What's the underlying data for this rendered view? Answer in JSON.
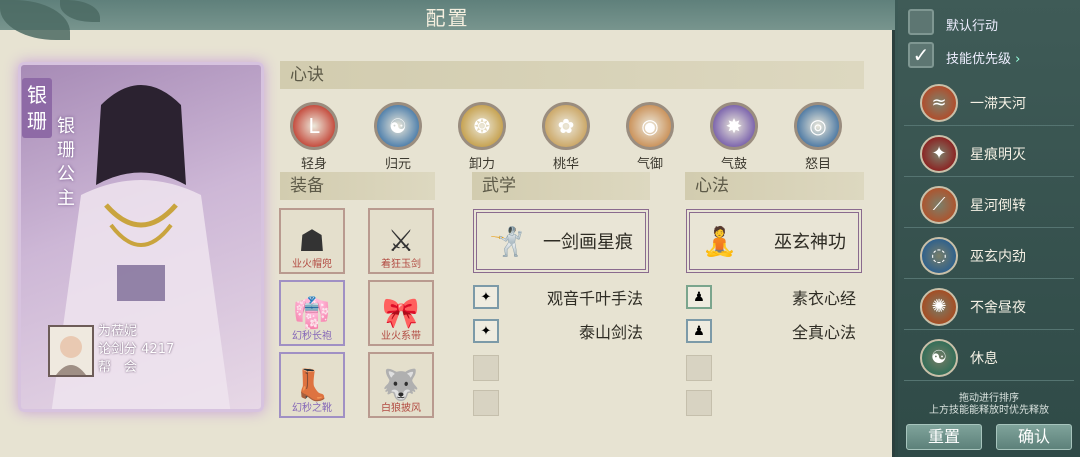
{
  "title": "配置",
  "character": {
    "name_vertical": "银珊",
    "title_vertical": "银珊公主",
    "player_name": "为莅妮",
    "score_label": "论剑分",
    "score": "4217",
    "guild_label": "帮　会"
  },
  "xinjue": {
    "header": "心诀",
    "skills": [
      {
        "label": "轻身",
        "icon": "red-glyph-icon",
        "color": "#c0392b"
      },
      {
        "label": "归元",
        "icon": "meditate-icon",
        "color": "#3e74a6"
      },
      {
        "label": "卸力",
        "icon": "swirl-icon",
        "color": "#c29a41"
      },
      {
        "label": "桃华",
        "icon": "dancer-icon",
        "color": "#c8a05a"
      },
      {
        "label": "气御",
        "icon": "vortex-icon",
        "color": "#c7894d"
      },
      {
        "label": "气鼓",
        "icon": "star-burst-icon",
        "color": "#6f55a8"
      },
      {
        "label": "怒目",
        "icon": "eye-icon",
        "color": "#3d6e9e"
      }
    ]
  },
  "equip": {
    "header": "装备",
    "items": [
      {
        "label": "业火帽兜",
        "icon": "hood-icon",
        "rarity": "red"
      },
      {
        "label": "着狂玉剑",
        "icon": "sword-icon",
        "rarity": "red"
      },
      {
        "label": "幻秒长袍",
        "icon": "robe-icon",
        "rarity": "purple"
      },
      {
        "label": "业火系带",
        "icon": "sash-icon",
        "rarity": "red"
      },
      {
        "label": "幻秒之靴",
        "icon": "boots-icon",
        "rarity": "purple"
      },
      {
        "label": "白狼披风",
        "icon": "cloak-icon",
        "rarity": "red"
      }
    ]
  },
  "wuxue": {
    "header": "武学",
    "main": "一剑画星痕",
    "subs": [
      "观音千叶手法",
      "泰山剑法"
    ]
  },
  "xinfa": {
    "header": "心法",
    "main": "巫玄神功",
    "subs": [
      "素衣心经",
      "全真心法"
    ]
  },
  "panel": {
    "default_action": "默认行动",
    "skill_priority": "技能优先级",
    "abilities": [
      {
        "label": "一滞天河",
        "icon": "river-icon",
        "color": "#b34a28"
      },
      {
        "label": "星痕明灭",
        "icon": "flame-icon",
        "color": "#8c1f1f"
      },
      {
        "label": "星河倒转",
        "icon": "slash-icon",
        "color": "#b0522b"
      },
      {
        "label": "巫玄内劲",
        "icon": "wave-icon",
        "color": "#2b5f8e"
      },
      {
        "label": "不舍昼夜",
        "icon": "burst-icon",
        "color": "#a84a1f"
      },
      {
        "label": "休息",
        "icon": "meditate-icon",
        "color": "#2f6d57"
      }
    ],
    "hint_line1": "拖动进行排序",
    "hint_line2": "上方技能能释放时优先释放",
    "reset": "重置",
    "confirm": "确认"
  }
}
